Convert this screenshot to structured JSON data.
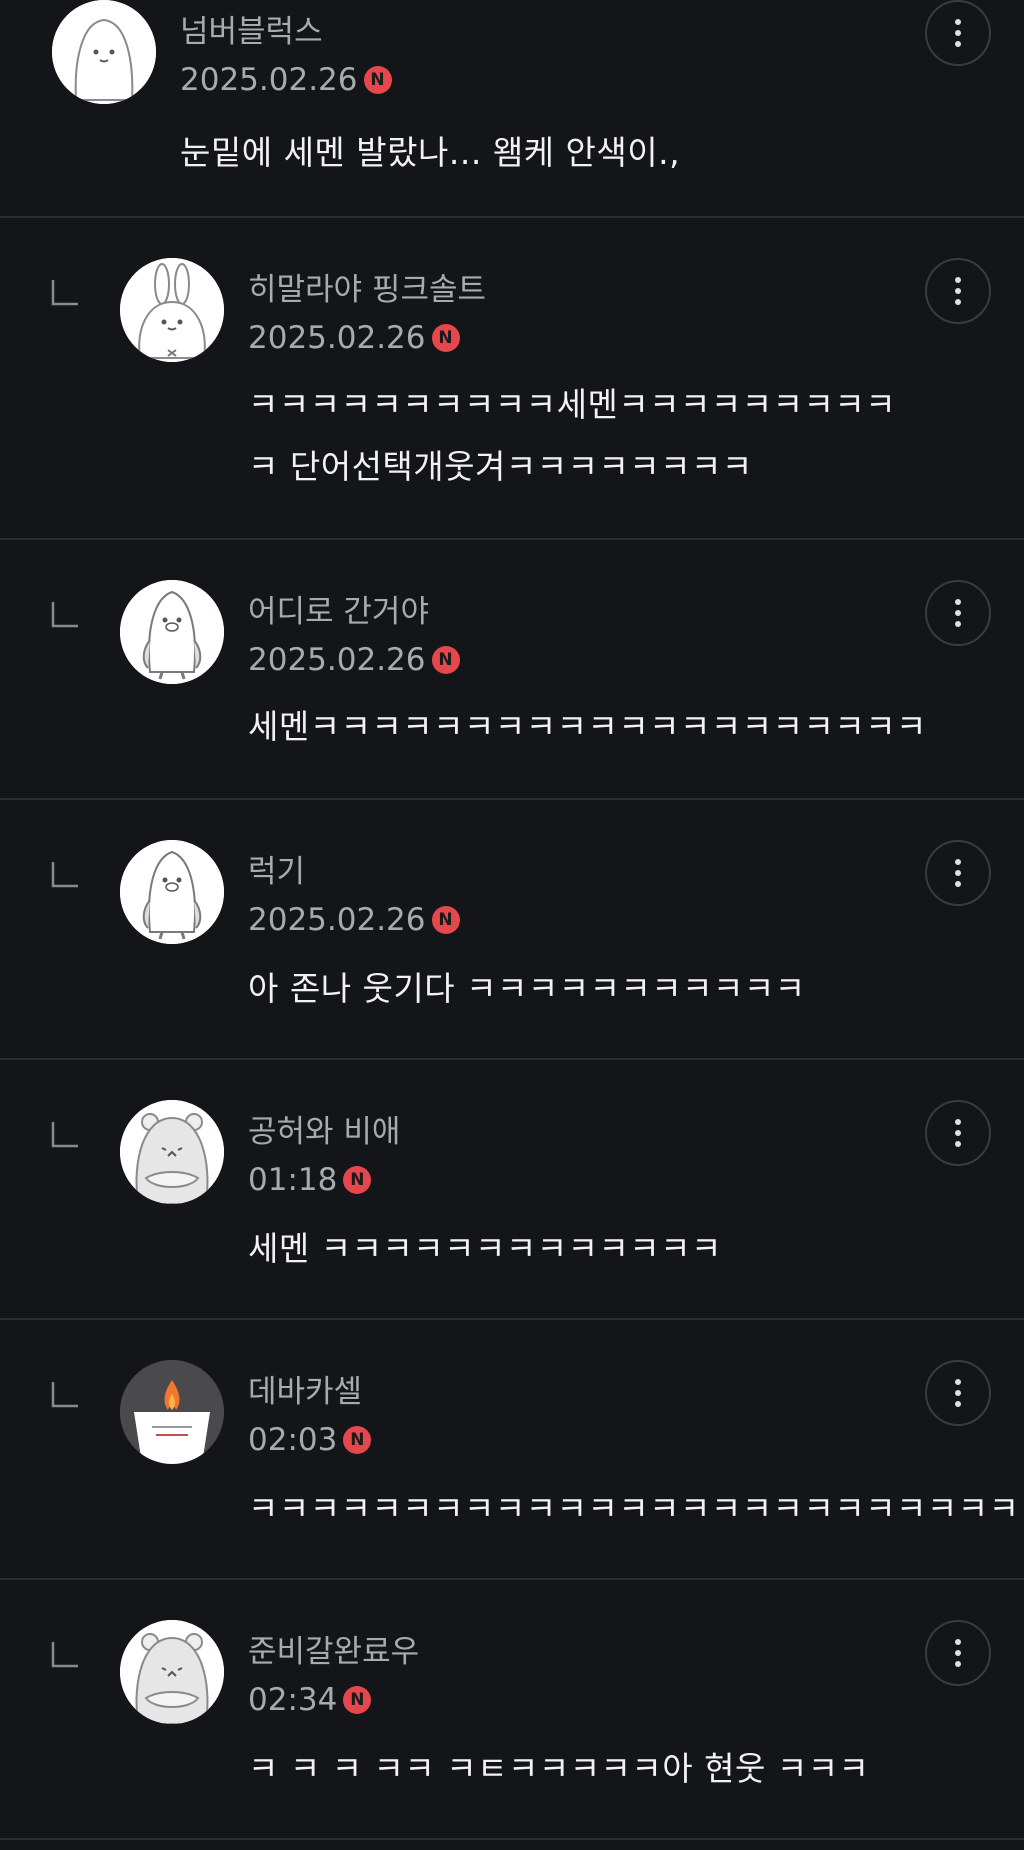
{
  "colors": {
    "background": "#141519",
    "divider": "#2c2d32",
    "new_badge": "#e5474c",
    "meta_text": "#a9aaae",
    "body_text": "#f2f2f2"
  },
  "comments": [
    {
      "nickname": "넘버블럭스",
      "date": "2025.02.26",
      "badge": "N",
      "text": "눈밑에 세멘 발랐나... 왬케 안색이.,",
      "avatar": "white-blob-character",
      "is_reply": false
    },
    {
      "nickname": "히말라야 핑크솔트",
      "date": "2025.02.26",
      "badge": "N",
      "text": "ㅋㅋㅋㅋㅋㅋㅋㅋㅋㅋ세멘ㅋㅋㅋㅋㅋㅋㅋㅋㅋ\nㅋ 단어선택개웃겨ㅋㅋㅋㅋㅋㅋㅋㅋ",
      "avatar": "rabbit-character",
      "is_reply": true
    },
    {
      "nickname": "어디로 간거야",
      "date": "2025.02.26",
      "badge": "N",
      "text": "세멘ㅋㅋㅋㅋㅋㅋㅋㅋㅋㅋㅋㅋㅋㅋㅋㅋㅋㅋㅋㅋ",
      "avatar": "penguin-character",
      "is_reply": true
    },
    {
      "nickname": "럭기",
      "date": "2025.02.26",
      "badge": "N",
      "text": "아 존나 웃기다 ㅋㅋㅋㅋㅋㅋㅋㅋㅋㅋㅋ",
      "avatar": "penguin-character",
      "is_reply": true
    },
    {
      "nickname": "공허와 비애",
      "date": "01:18",
      "badge": "N",
      "text": "세멘 ㅋㅋㅋㅋㅋㅋㅋㅋㅋㅋㅋㅋㅋ",
      "avatar": "bear-character",
      "is_reply": true
    },
    {
      "nickname": "데바카셀",
      "date": "02:03",
      "badge": "N",
      "text": "ㅋㅋㅋㅋㅋㅋㅋㅋㅋㅋㅋㅋㅋㅋㅋㅋㅋㅋㅋㅋㅋㅋㅋㅋㅋ",
      "avatar": "candle-memorial",
      "is_reply": true
    },
    {
      "nickname": "준비갈완료우",
      "date": "02:34",
      "badge": "N",
      "text": "ㅋ ㅋ ㅋ ㅋㅋ ㅋㅌㅋㅋㅋㅋㅋ아 현웃 ㅋㅋㅋ",
      "avatar": "bear-character",
      "is_reply": true
    }
  ]
}
